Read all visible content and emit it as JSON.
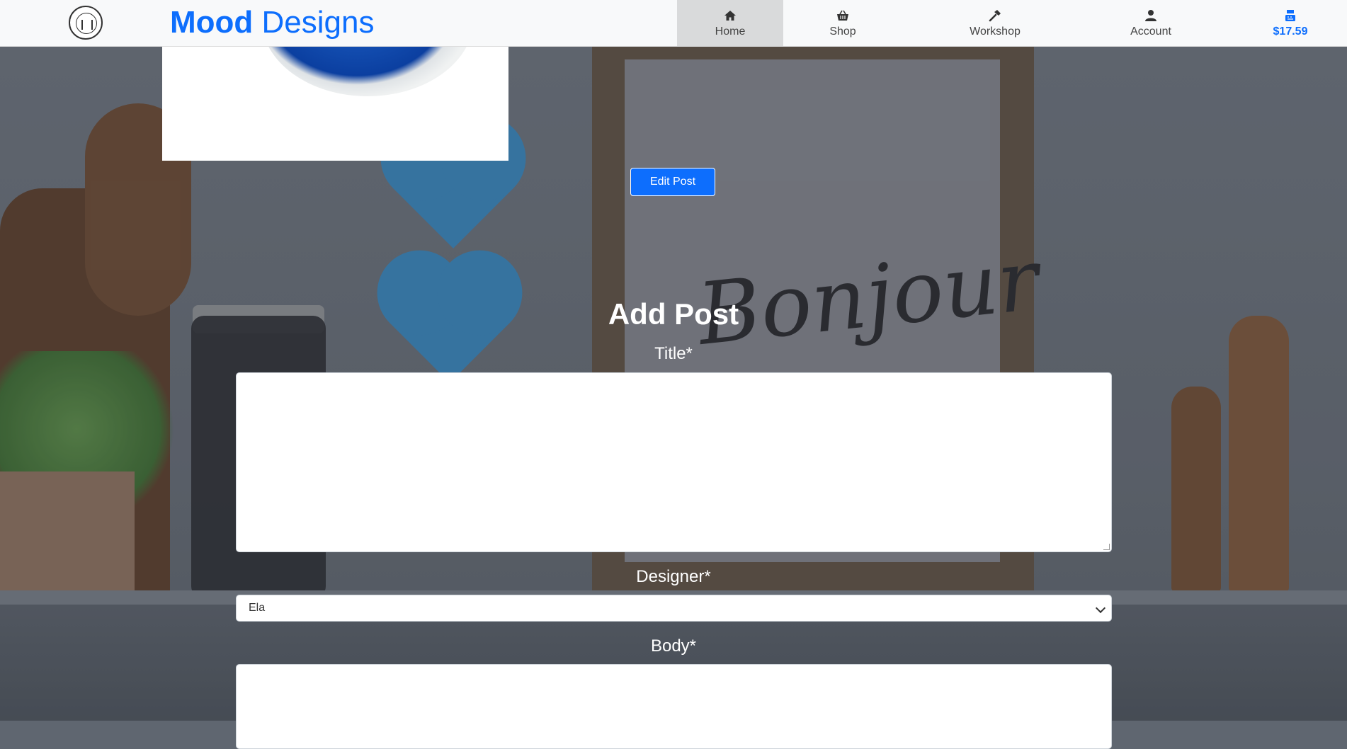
{
  "brand": {
    "part1": "Mood",
    "part2": "Designs"
  },
  "nav": {
    "home": "Home",
    "shop": "Shop",
    "workshop": "Workshop",
    "account": "Account",
    "cart": "$17.59"
  },
  "post": {
    "edit_label": "Edit Post"
  },
  "form": {
    "heading": "Add Post",
    "title_label": "Title*",
    "designer_label": "Designer*",
    "designer_value": "Ela",
    "body_label": "Body*"
  },
  "icons": [
    "logo-icon",
    "home-icon",
    "basket-icon",
    "hammer-icon",
    "person-icon",
    "register-icon"
  ],
  "colors": {
    "accent": "#0d6efd",
    "navbar": "#f8f9fa",
    "active_tab": "#d9dadb"
  }
}
